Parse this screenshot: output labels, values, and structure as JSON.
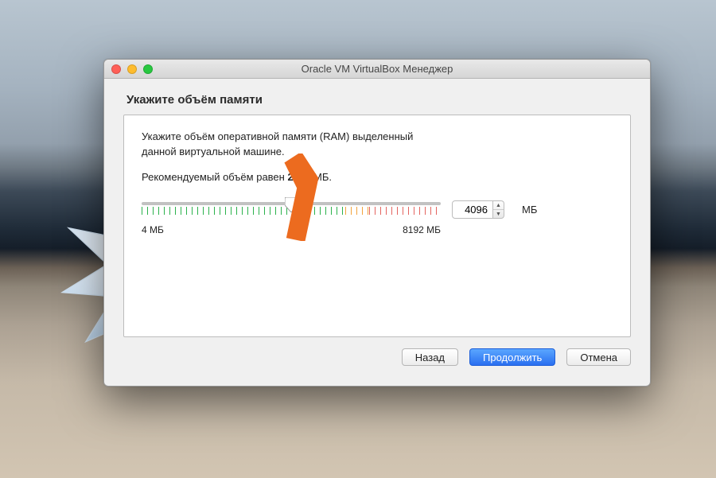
{
  "window": {
    "title": "Oracle VM VirtualBox Менеджер"
  },
  "heading": "Укажите объём памяти",
  "description": "Укажите объём оперативной памяти (RAM) выделенный данной виртуальной машине.",
  "recommended_prefix": "Рекомендуемый объём равен ",
  "recommended_value": "2048",
  "recommended_suffix": " МБ.",
  "slider": {
    "min_label": "4 МБ",
    "max_label": "8192 МБ",
    "min": 4,
    "max": 8192,
    "value": 4096,
    "thumb_percent": 50,
    "green_end_percent": 68,
    "orange_end_percent": 76
  },
  "input": {
    "value": "4096",
    "unit": "МБ"
  },
  "buttons": {
    "back": "Назад",
    "continue": "Продолжить",
    "cancel": "Отмена"
  }
}
